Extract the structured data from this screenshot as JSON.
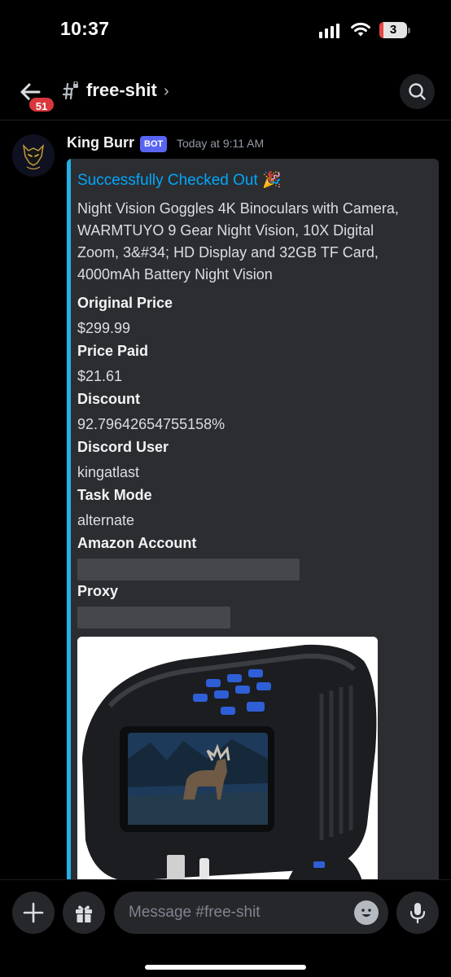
{
  "status": {
    "time": "10:37",
    "battery": "3",
    "icons": [
      "signal-icon",
      "wifi-icon",
      "battery-icon"
    ]
  },
  "header": {
    "back_icon": "arrow-left-icon",
    "unread_count": "51",
    "channel_icon": "locked-hash-icon",
    "channel_name": "free-shit",
    "chevron": "›",
    "search_icon": "search-icon"
  },
  "message": {
    "author": "King Burr",
    "bot_tag": "BOT",
    "timestamp": "Today at 9:11 AM",
    "embed": {
      "accent_color": "#23b1e6",
      "title": "Successfully Checked Out 🎉",
      "description": "Night Vision Goggles 4K Binoculars with Camera, WARMTUYO 9 Gear Night Vision, 10X Digital Zoom, 3&#34; HD Display and 32GB TF Card, 4000mAh Battery Night Vision",
      "fields": [
        {
          "name": "Original Price",
          "value": "$299.99"
        },
        {
          "name": "Price Paid",
          "value": "$21.61"
        },
        {
          "name": "Discount",
          "value": "92.79642654755158%"
        },
        {
          "name": "Discord User",
          "value": "kingatlast"
        },
        {
          "name": "Task Mode",
          "value": "alternate"
        },
        {
          "name": "Amazon Account",
          "value": ""
        },
        {
          "name": "Proxy",
          "value": ""
        }
      ],
      "image": "night-vision-binoculars-product-photo"
    }
  },
  "composer": {
    "plus_icon": "plus-icon",
    "gift_icon": "gift-icon",
    "placeholder": "Message #free-shit",
    "emoji_icon": "emoji-icon",
    "mic_icon": "microphone-icon"
  }
}
